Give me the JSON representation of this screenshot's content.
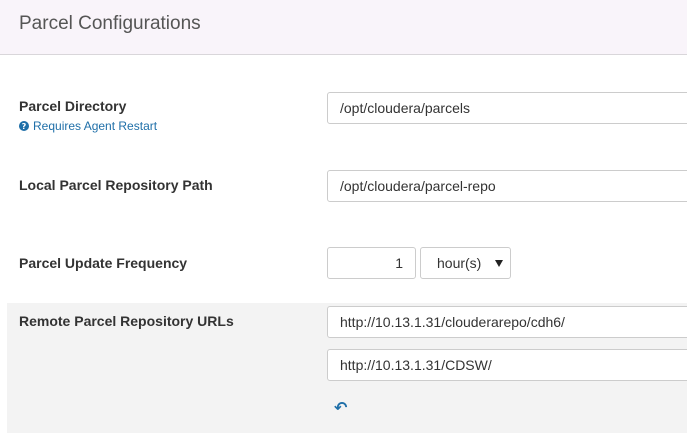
{
  "header": {
    "title": "Parcel Configurations"
  },
  "parcel_directory": {
    "label": "Parcel Directory",
    "hint": "Requires Agent Restart",
    "value": "/opt/cloudera/parcels"
  },
  "local_repo": {
    "label": "Local Parcel Repository Path",
    "value": "/opt/cloudera/parcel-repo"
  },
  "update_frequency": {
    "label": "Parcel Update Frequency",
    "value": "1",
    "unit": "hour(s)"
  },
  "remote_urls": {
    "label": "Remote Parcel Repository URLs",
    "urls": [
      "http://10.13.1.31/clouderarepo/cdh6/",
      "http://10.13.1.31/CDSW/"
    ]
  },
  "icons": {
    "help": "question-circle-icon",
    "undo": "undo-arrow-icon"
  },
  "colors": {
    "link": "#1f6fa8",
    "header_bg": "#f9f4fa"
  }
}
